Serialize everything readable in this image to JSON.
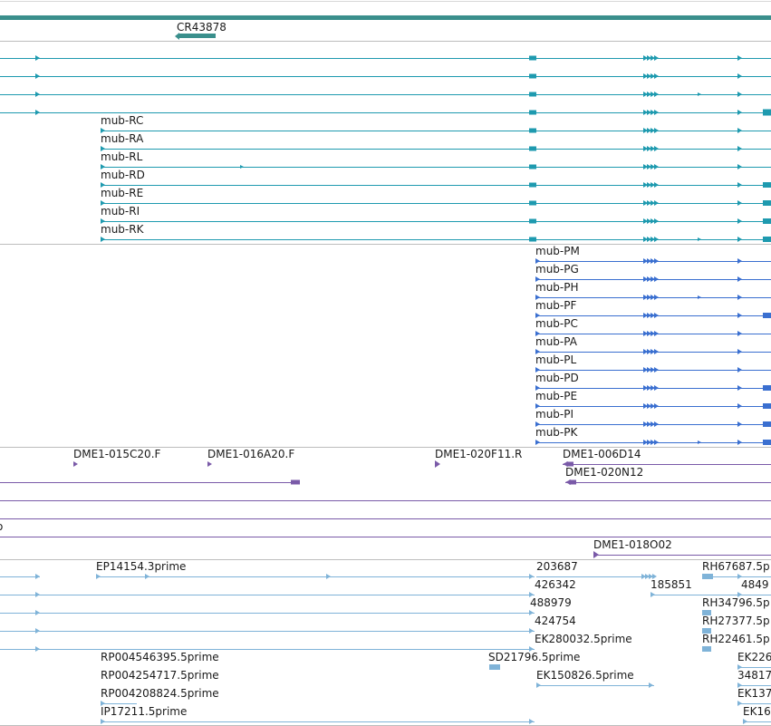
{
  "colors": {
    "top_bar": "#3a8f8c",
    "nc_gene": "#3a8f8c",
    "mrna_teal": "#1e9aaf",
    "mrna_blue": "#3a6fd0",
    "clone": "#7a5aa8",
    "est": "#7fb3d8",
    "separator": "#bdbdbd"
  },
  "tracks": {
    "noncoding": {
      "label": "CR43878"
    },
    "transcripts_r": [
      {
        "label": "mub-RC"
      },
      {
        "label": "mub-RA"
      },
      {
        "label": "mub-RL"
      },
      {
        "label": "mub-RD"
      },
      {
        "label": "mub-RE"
      },
      {
        "label": "mub-RI"
      },
      {
        "label": "mub-RK"
      }
    ],
    "transcripts_p": [
      {
        "label": "mub-PM"
      },
      {
        "label": "mub-PG"
      },
      {
        "label": "mub-PH"
      },
      {
        "label": "mub-PF"
      },
      {
        "label": "mub-PC"
      },
      {
        "label": "mub-PA"
      },
      {
        "label": "mub-PL"
      },
      {
        "label": "mub-PD"
      },
      {
        "label": "mub-PE"
      },
      {
        "label": "mub-PI"
      },
      {
        "label": "mub-PK"
      }
    ],
    "clones": [
      {
        "label": "DME1-015C20.F"
      },
      {
        "label": "DME1-016A20.F"
      },
      {
        "label": "DME1-020F11.R"
      },
      {
        "label": "DME1-006D14"
      },
      {
        "label": "DME1-020N12"
      },
      {
        "label": "DME1-018O02"
      }
    ],
    "ests": [
      {
        "label": "EP14154.3prime"
      },
      {
        "label": "203687"
      },
      {
        "label": "RH67687.5p"
      },
      {
        "label": "426342"
      },
      {
        "label": "185851"
      },
      {
        "label": "4849"
      },
      {
        "label": "488979"
      },
      {
        "label": "RH34796.5p"
      },
      {
        "label": "424754"
      },
      {
        "label": "RH27377.5p"
      },
      {
        "label": "EK280032.5prime"
      },
      {
        "label": "RH22461.5p"
      },
      {
        "label": "RP004546395.5prime"
      },
      {
        "label": "SD21796.5prime"
      },
      {
        "label": "EK226"
      },
      {
        "label": "RP004254717.5prime"
      },
      {
        "label": "EK150826.5prime"
      },
      {
        "label": "34817"
      },
      {
        "label": "RP004208824.5prime"
      },
      {
        "label": "EK137"
      },
      {
        "label": "IP17211.5prime"
      },
      {
        "label": "EK16"
      }
    ],
    "cut_label": "o"
  }
}
